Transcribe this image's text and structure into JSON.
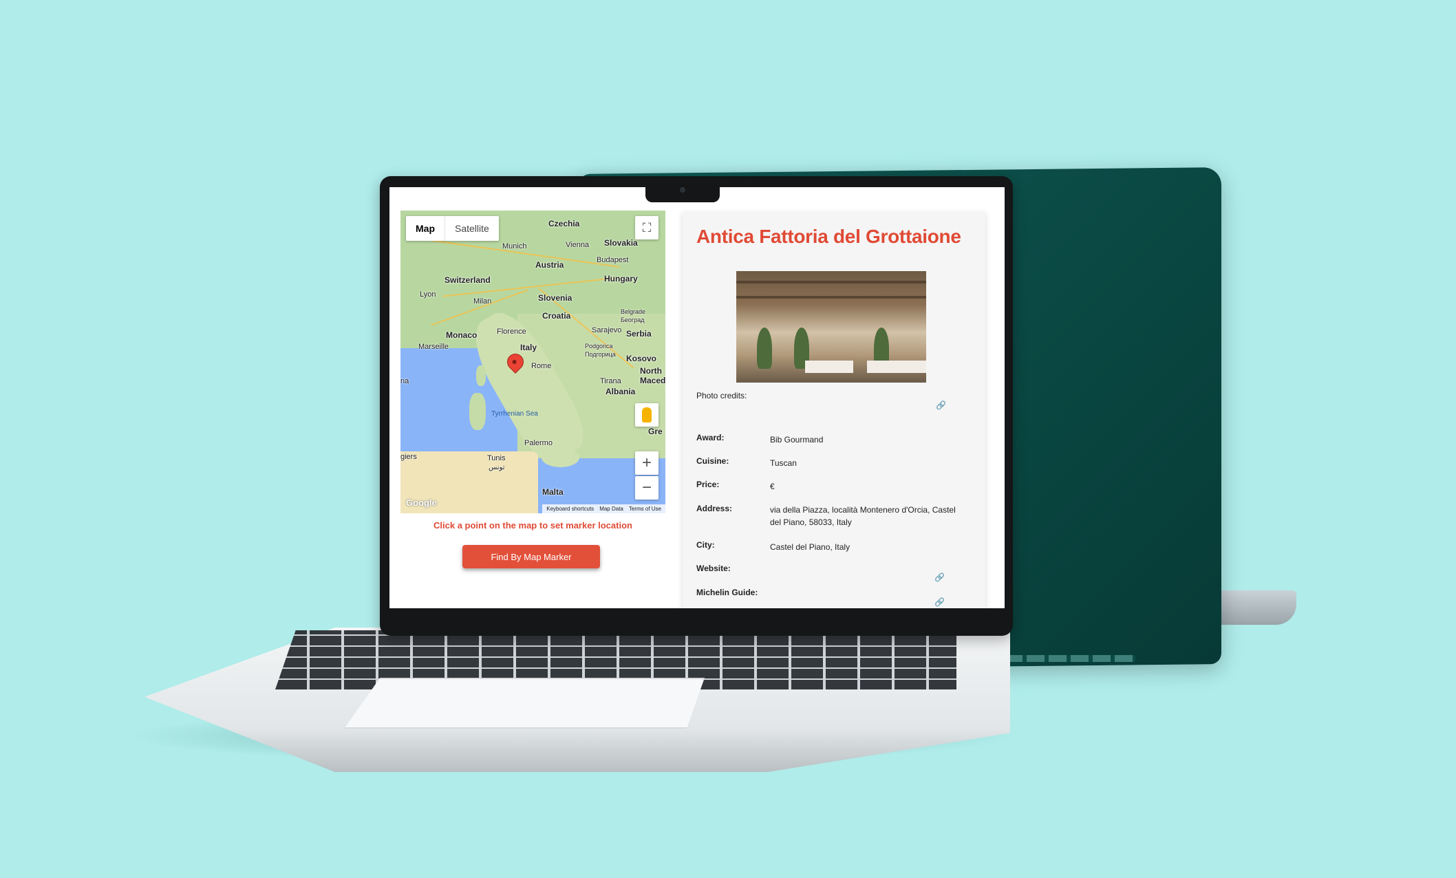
{
  "map": {
    "toggle": {
      "map_label": "Map",
      "satellite_label": "Satellite"
    },
    "labels": {
      "czechia": "Czechia",
      "munich": "Munich",
      "vienna": "Vienna",
      "slovakia": "Slovakia",
      "budapest": "Budapest",
      "austria": "Austria",
      "switzerland": "Switzerland",
      "hungary": "Hungary",
      "lyon": "Lyon",
      "milan": "Milan",
      "slovenia": "Slovenia",
      "croatia": "Croatia",
      "belgrade": "Belgrade",
      "belgrade_cyr": "Београд",
      "florence": "Florence",
      "sarajevo": "Sarajevo",
      "serbia": "Serbia",
      "monaco": "Monaco",
      "marseille": "Marseille",
      "italy": "Italy",
      "podgorica": "Podgorica",
      "podgorica_cyr": "Подгорица",
      "kosovo": "Kosovo",
      "rome": "Rome",
      "north_macedonia": "North Macedon",
      "tirana": "Tirana",
      "albania": "Albania",
      "tyrrhenian_sea": "Tyrrhenian Sea",
      "palermo": "Palermo",
      "tunis": "Tunis",
      "tunis_ar": "تونس",
      "algiers": "giers",
      "malta": "Malta",
      "gre": "Gre",
      "na": "na"
    },
    "attribution": {
      "shortcuts": "Keyboard shortcuts",
      "data": "Map Data",
      "terms": "Terms of Use"
    },
    "logo": "Google",
    "hint": "Click a point on the map to set marker location",
    "find_button": "Find By Map Marker"
  },
  "restaurant": {
    "name": "Antica Fattoria del Grottaione",
    "photo_credits_label": "Photo credits:",
    "fields": [
      {
        "label": "Award:",
        "value": "Bib Gourmand"
      },
      {
        "label": "Cuisine:",
        "value": "Tuscan"
      },
      {
        "label": "Price:",
        "value": "€"
      },
      {
        "label": "Address:",
        "value": "via della Piazza, località Montenero d'Orcia, Castel del Piano, 58033, Italy"
      },
      {
        "label": "City:",
        "value": "Castel del Piano, Italy"
      },
      {
        "label": "Website:",
        "value": ""
      },
      {
        "label": "Michelin Guide:",
        "value": ""
      }
    ]
  },
  "icons": {
    "fullscreen": "fullscreen-icon",
    "pegman": "pegman-icon",
    "zoom_in": "plus-icon",
    "zoom_out": "minus-icon",
    "link": "link-icon",
    "marker": "map-marker-icon"
  },
  "colors": {
    "background": "#afecea",
    "accent": "#e04a35",
    "back_laptop": "#0a4843",
    "panel": "#f5f5f5"
  }
}
